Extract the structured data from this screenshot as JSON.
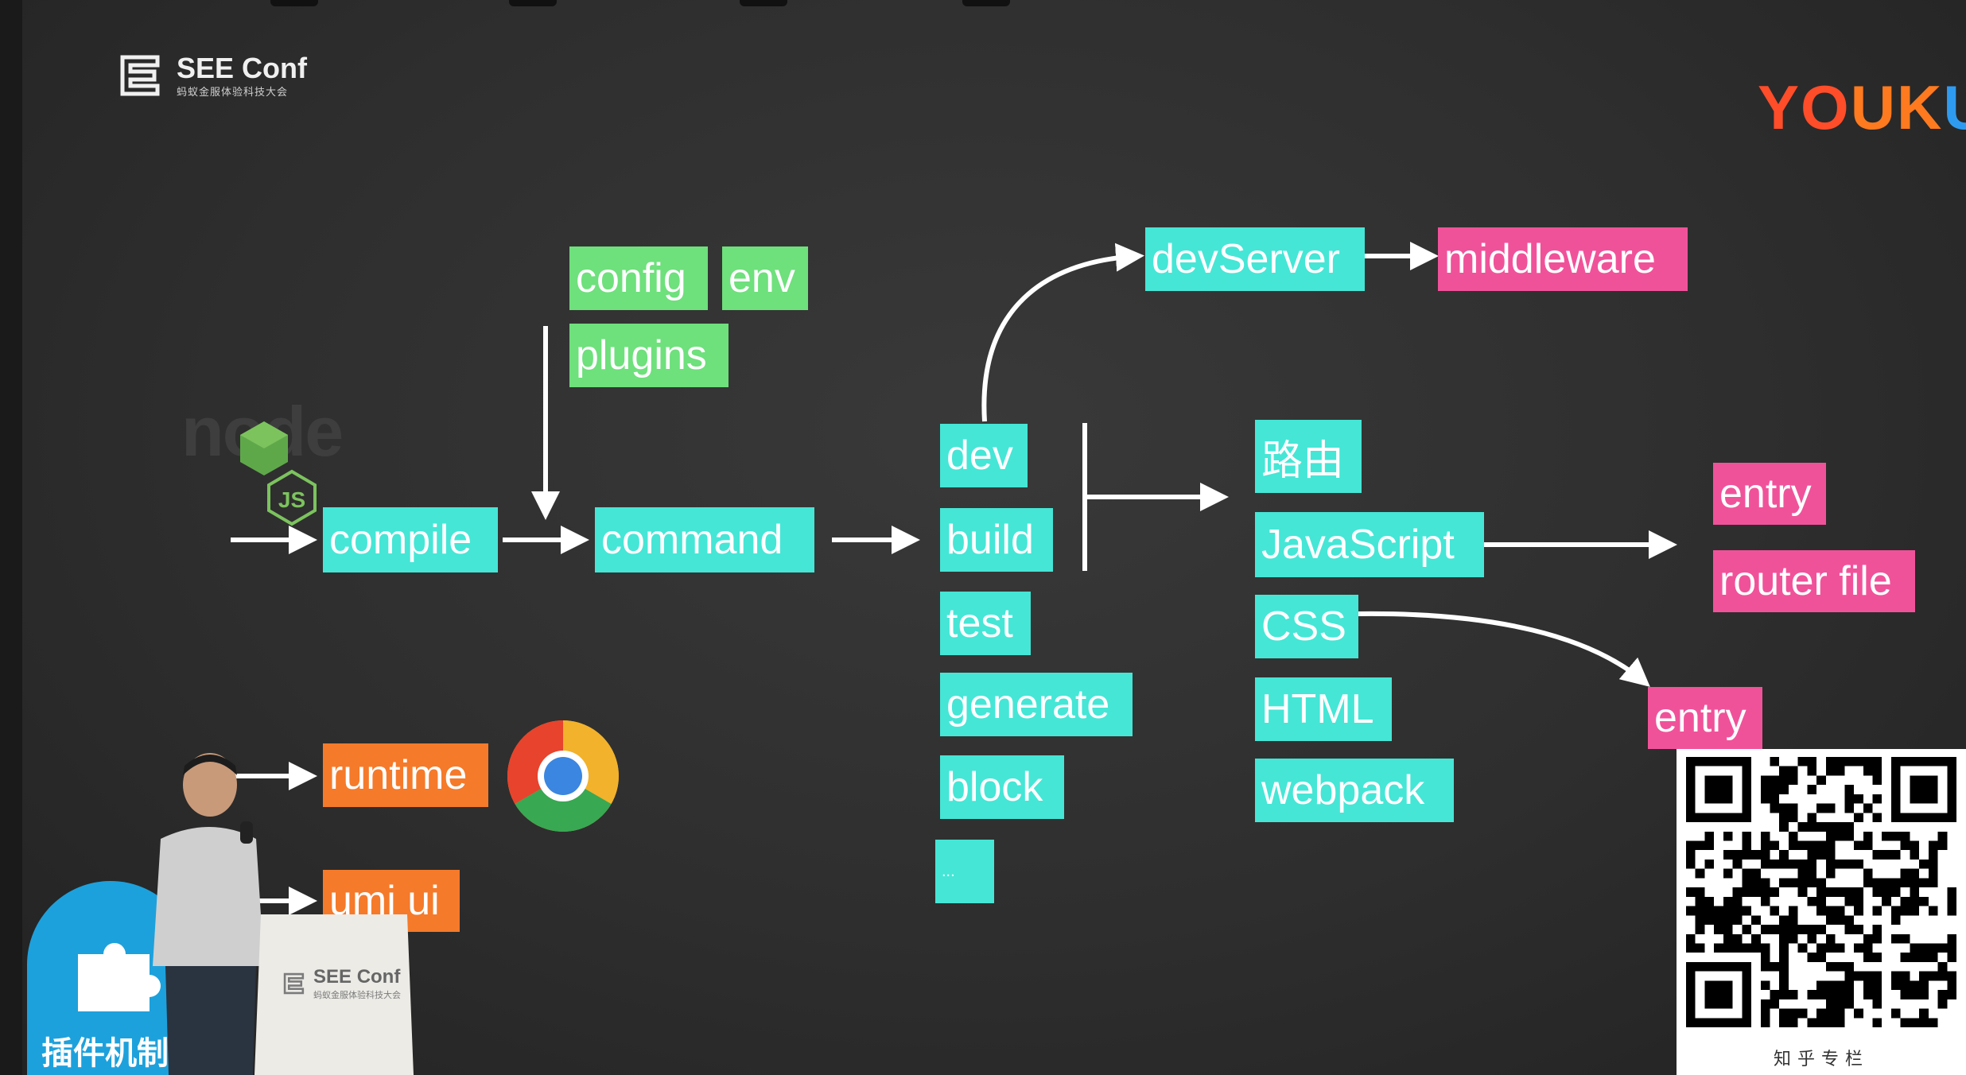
{
  "branding": {
    "conference": "SEE Conf",
    "conference_subtitle": "蚂蚁金服体验科技大会",
    "watermark_letters": [
      "YO",
      "UK",
      "U"
    ],
    "podium_brand": "SEE Conf",
    "podium_subtitle": "蚂蚁金服体验科技大会",
    "qr_caption": "知乎专栏",
    "section_badge": "插件机制",
    "node_word": "node"
  },
  "diagram": {
    "config": "config",
    "env": "env",
    "plugins": "plugins",
    "compile": "compile",
    "command": "command",
    "commands": [
      "dev",
      "build",
      "test",
      "generate",
      "block",
      "..."
    ],
    "devServer": "devServer",
    "middleware": "middleware",
    "build_outputs": [
      "路由",
      "JavaScript",
      "CSS",
      "HTML",
      "webpack"
    ],
    "js_targets": [
      "entry",
      "router file"
    ],
    "css_target": "entry",
    "runtime": "runtime",
    "umi_ui": "umi ui"
  },
  "colors": {
    "input_green": "#6ee07c",
    "core_cyan": "#45e6d6",
    "target_pink": "#f0529a",
    "runtime_orange": "#f57a2a",
    "badge_blue": "#1da1dc"
  }
}
